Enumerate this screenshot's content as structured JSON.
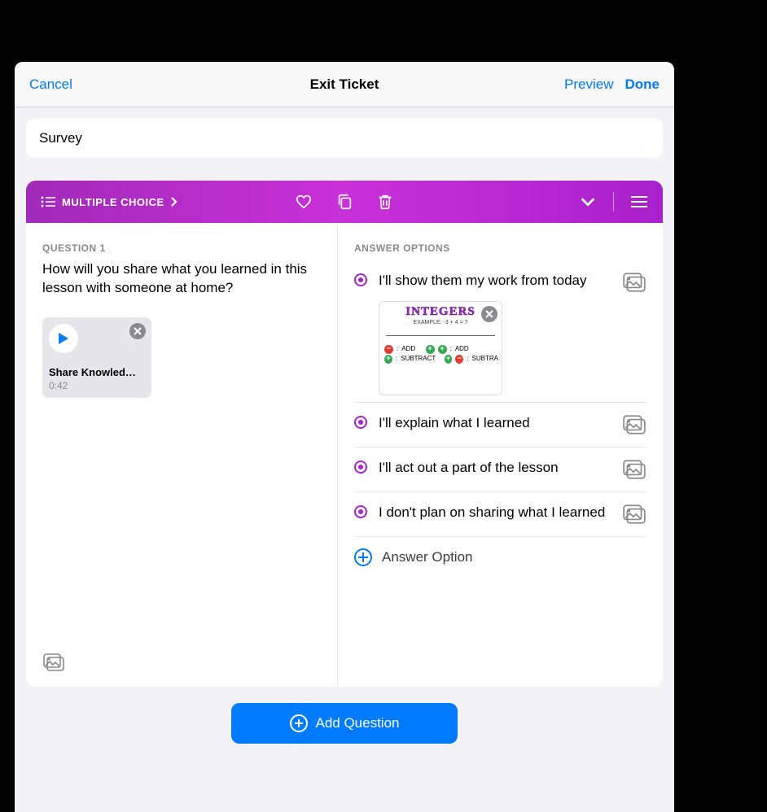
{
  "nav": {
    "cancel": "Cancel",
    "title": "Exit Ticket",
    "preview": "Preview",
    "done": "Done"
  },
  "form": {
    "title": "Survey"
  },
  "question": {
    "type_label": "MULTIPLE CHOICE",
    "label": "QUESTION 1",
    "text": "How will you share what you learned in this lesson with someone at home?",
    "media": {
      "title": "Share Knowled…",
      "duration": "0:42"
    },
    "answers_label": "ANSWER OPTIONS",
    "answers": [
      {
        "text": "I'll show them my work from today",
        "has_image": true
      },
      {
        "text": "I'll explain what I learned",
        "has_image": false
      },
      {
        "text": "I'll act out a part of the lesson",
        "has_image": false
      },
      {
        "text": "I don't plan on sharing what I learned",
        "has_image": false
      }
    ],
    "image_thumb": {
      "title": "INTEGERS",
      "subtitle": "EXAMPLE: -3 + 4 = ?",
      "r1a": "ADD",
      "r1b": "ADD",
      "r2a": "SUBTRACT",
      "r2b": "SUBTRA"
    },
    "add_option": "Answer Option"
  },
  "footer": {
    "add_question": "Add Question"
  },
  "icons": {
    "list": "list-icon",
    "chevron_right": "chevron-right-icon",
    "heart": "heart-icon",
    "duplicate": "duplicate-icon",
    "trash": "trash-icon",
    "chevron_down": "chevron-down-icon",
    "grip": "grip-icon",
    "play": "play-icon",
    "close": "close-icon",
    "media": "media-icon",
    "plus": "plus-icon"
  }
}
